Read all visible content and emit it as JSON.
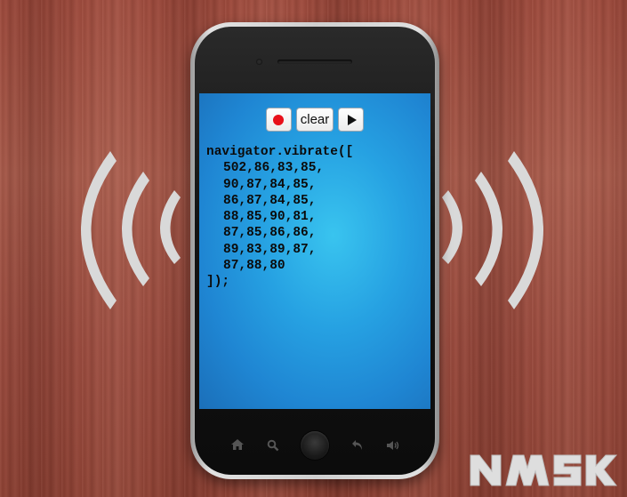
{
  "toolbar": {
    "record_icon": "record-icon",
    "clear_label": "clear",
    "play_icon": "play-icon"
  },
  "code": {
    "lines": [
      "navigator.vibrate([",
      "502,86,83,85,",
      "90,87,84,85,",
      "86,87,84,85,",
      "88,85,90,81,",
      "87,85,86,86,",
      "89,83,89,87,",
      "87,88,80",
      "]);"
    ]
  },
  "nav": {
    "icons": [
      "home-icon",
      "search-icon",
      "home-button",
      "back-icon",
      "volume-icon"
    ]
  },
  "colors": {
    "record": "#e8101a",
    "screen": "#26a1e2"
  }
}
